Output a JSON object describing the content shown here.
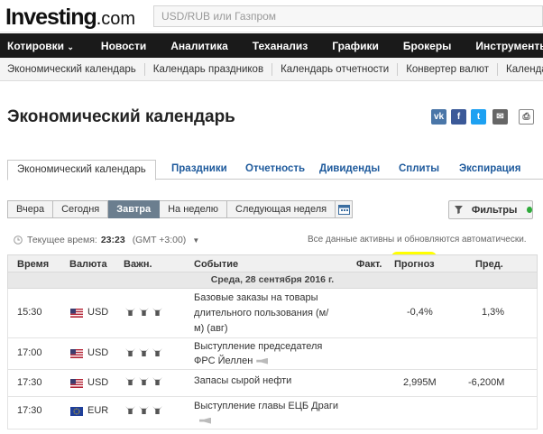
{
  "header": {
    "logo_main": "Investing",
    "logo_suffix": ".com",
    "search_placeholder": "USD/RUB или Газпром"
  },
  "main_nav": [
    "Котировки",
    "Новости",
    "Аналитика",
    "Теханализ",
    "Графики",
    "Брокеры",
    "Инструменты"
  ],
  "sub_nav": [
    "Экономический календарь",
    "Календарь праздников",
    "Календарь отчетности",
    "Конвертер валют",
    "Календа"
  ],
  "page": {
    "title": "Экономический календарь",
    "share_icons": [
      "vk-icon",
      "facebook-icon",
      "twitter-icon",
      "mail-icon",
      "print-icon"
    ]
  },
  "tabs": [
    "Экономический календарь",
    "Праздники",
    "Отчетность",
    "Дивиденды",
    "Сплиты",
    "Экспирация"
  ],
  "filter_buttons": [
    "Вчера",
    "Сегодня",
    "Завтра",
    "На неделю",
    "Следующая неделя"
  ],
  "active_filter": "Завтра",
  "filters_label": "Фильтры",
  "time_info": {
    "label": "Текущее время:",
    "time": "23:23",
    "tz": "(GMT +3:00)",
    "auto_text": "Все данные активны и обновляются автоматически."
  },
  "table": {
    "headers": {
      "time": "Время",
      "currency": "Валюта",
      "importance": "Важн.",
      "event": "Событие",
      "actual": "Факт.",
      "forecast": "Прогноз",
      "previous": "Пред."
    },
    "date_row": "Среда, 28 сентября 2016 г.",
    "rows": [
      {
        "time": "15:30",
        "currency": "USD",
        "importance": 3,
        "event_line1": "Базовые заказы на товары",
        "event_line2": "длительного пользования (м/",
        "event_line3": "м) (авг)",
        "actual": "",
        "forecast": "-0,4%",
        "previous": "1,3%"
      },
      {
        "time": "17:00",
        "currency": "USD",
        "importance": 3,
        "event_line1": "Выступление председателя",
        "event_line2": "ФРС Йеллен",
        "actual": "",
        "forecast": "",
        "previous": ""
      },
      {
        "time": "17:30",
        "currency": "USD",
        "importance": 3,
        "event_line1": "Запасы сырой нефти",
        "actual": "",
        "forecast": "2,995M",
        "previous": "-6,200M"
      },
      {
        "time": "17:30",
        "currency": "EUR",
        "importance": 3,
        "event_line1": "Выступление главы ЕЦБ Драги",
        "actual": "",
        "forecast": "",
        "previous": ""
      }
    ]
  },
  "colors": {
    "nav_bg": "#1a1a1a",
    "link": "#1e5a9c",
    "active_filter": "#6b7e8f",
    "highlight": "#ffff00",
    "filter_dot": "#2eaa3a"
  }
}
